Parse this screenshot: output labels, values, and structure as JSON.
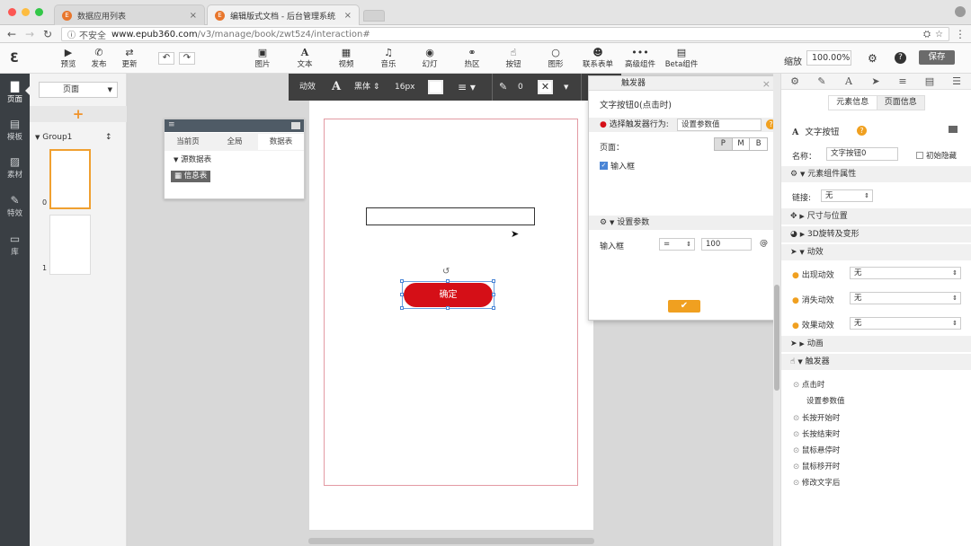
{
  "browser": {
    "tabs": [
      {
        "title": "数据应用列表",
        "favicon": "E"
      },
      {
        "title": "编辑版式文档 - 后台管理系统",
        "favicon": "E"
      }
    ],
    "security": "不安全",
    "url_host": "www.epub360.com",
    "url_path": "/v3/manage/book/zwt5z4/interaction#"
  },
  "toolbar": {
    "left": [
      {
        "label": "预览",
        "icon": "play-icon"
      },
      {
        "label": "发布",
        "icon": "wechat-icon"
      },
      {
        "label": "更新",
        "icon": "refresh-icon"
      }
    ],
    "tools": [
      {
        "label": "图片",
        "icon": "image-icon"
      },
      {
        "label": "文本",
        "icon": "text-icon"
      },
      {
        "label": "视频",
        "icon": "video-icon"
      },
      {
        "label": "音乐",
        "icon": "music-icon"
      },
      {
        "label": "幻灯",
        "icon": "slideshow-icon"
      },
      {
        "label": "热区",
        "icon": "hotspot-icon"
      },
      {
        "label": "按钮",
        "icon": "hand-icon"
      },
      {
        "label": "图形",
        "icon": "shape-icon"
      },
      {
        "label": "联系表单",
        "icon": "form-icon"
      },
      {
        "label": "高级组件",
        "icon": "more-icon"
      },
      {
        "label": "Beta组件",
        "icon": "beta-icon"
      }
    ],
    "zoom_label": "缩放",
    "zoom_value": "100.00%",
    "save_label": "保存"
  },
  "rail": [
    {
      "label": "页面",
      "icon": "page-icon"
    },
    {
      "label": "模板",
      "icon": "template-icon"
    },
    {
      "label": "素材",
      "icon": "material-icon"
    },
    {
      "label": "特效",
      "icon": "effect-icon"
    },
    {
      "label": "库",
      "icon": "library-icon"
    }
  ],
  "pages": {
    "select_label": "页面",
    "group_label": "Group1",
    "page_numbers": [
      "0",
      "1"
    ]
  },
  "datapanel": {
    "tabs": [
      "当前页",
      "全局",
      "数据表"
    ],
    "source_label": "源数据表",
    "table_label": "信息表"
  },
  "format_bar": {
    "animation": "动效",
    "font": "黑体",
    "size": "16px",
    "border_width": "0"
  },
  "canvas": {
    "button_text": "确定"
  },
  "trigger_dialog": {
    "title": "触发器",
    "subtitle": "文字按钮0(点击时)",
    "action_label": "选择触发器行为:",
    "action_value": "设置参数值",
    "page_label": "页面：",
    "page_options": [
      "P",
      "M",
      "B"
    ],
    "checkbox_label": "输入框",
    "params_section": "设置参数",
    "param_name": "输入框",
    "param_op": "=",
    "param_value": "100",
    "at_symbol": "@"
  },
  "properties": {
    "tabs": [
      "元素信息",
      "页面信息"
    ],
    "element_type": "文字按钮",
    "name_label": "名称：",
    "name_value": "文字按钮0",
    "hide_label": "初始隐藏",
    "attr_section": "元素组件属性",
    "link_label": "链接:",
    "link_value": "无",
    "size_section": "尺寸与位置",
    "rotate_section": "3D旋转及变形",
    "anim_section": "动效",
    "appear_label": "出现动效",
    "disappear_label": "消失动效",
    "effect_label": "效果动效",
    "none": "无",
    "animation_section": "动画",
    "trigger_section": "触发器",
    "trigger_items": [
      "点击时",
      "设置参数值",
      "长按开始时",
      "长按结束时",
      "鼠标悬停时",
      "鼠标移开时",
      "修改文字后"
    ]
  },
  "colors": {
    "accent": "#f0a020",
    "button": "#d50f17",
    "rail": "#3a3f44"
  }
}
